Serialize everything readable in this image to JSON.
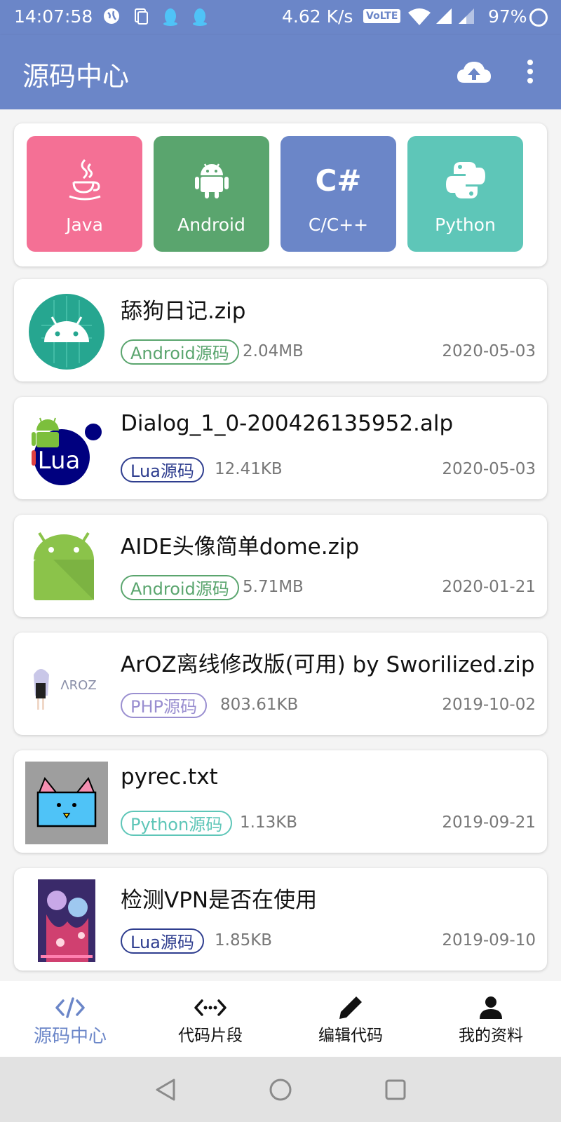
{
  "status_bar": {
    "time": "14:07:58",
    "net_speed": "4.62 K/s",
    "volte": "VoLTE",
    "battery": "97%"
  },
  "app_bar": {
    "title": "源码中心",
    "actions": [
      "upload-cloud-icon",
      "more-vert-icon"
    ]
  },
  "categories": [
    {
      "label": "Java",
      "icon": "java-icon",
      "color": "#f47095"
    },
    {
      "label": "Android",
      "icon": "android-icon",
      "color": "#5aa56e"
    },
    {
      "label": "C/C++",
      "icon": "csharp-icon",
      "glyph": "C#",
      "color": "#6b86c8"
    },
    {
      "label": "Python",
      "icon": "python-icon",
      "color": "#5ec6b8"
    }
  ],
  "files": [
    {
      "name": "舔狗日记.zip",
      "tag": "Android源码",
      "tag_color": "#5aa56e",
      "size": "2.04MB",
      "date": "2020-05-03",
      "icon": "android-round-icon"
    },
    {
      "name": "Dialog_1_0-200426135952.alp",
      "tag": "Lua源码",
      "tag_color": "#2f3e8f",
      "size": "12.41KB",
      "date": "2020-05-03",
      "icon": "lua-logo-icon",
      "thumb_text": "Lua"
    },
    {
      "name": "AIDE头像简单dome.zip",
      "tag": "Android源码",
      "tag_color": "#5aa56e",
      "size": "5.71MB",
      "date": "2020-01-21",
      "icon": "aide-android-icon"
    },
    {
      "name": "ArOZ离线修改版(可用) by Sworilized.zip",
      "tag": "PHP源码",
      "tag_color": "#9a8fd0",
      "size": "803.61KB",
      "date": "2019-10-02",
      "icon": "aroz-logo-icon",
      "thumb_text": "ΛROZ"
    },
    {
      "name": "pyrec.txt",
      "tag": "Python源码",
      "tag_color": "#5ec6b8",
      "size": "1.13KB",
      "date": "2019-09-21",
      "icon": "cat-box-icon"
    },
    {
      "name": "检测VPN是否在使用",
      "tag": "Lua源码",
      "tag_color": "#2f3e8f",
      "size": "1.85KB",
      "date": "2019-09-10",
      "icon": "anime-art-thumbnail"
    }
  ],
  "bottom_nav": [
    {
      "label": "源码中心",
      "icon": "code-icon",
      "active": true
    },
    {
      "label": "代码片段",
      "icon": "code-snippet-icon",
      "active": false
    },
    {
      "label": "编辑代码",
      "icon": "pencil-icon",
      "active": false
    },
    {
      "label": "我的资料",
      "icon": "person-icon",
      "active": false
    }
  ],
  "system_nav": [
    "back-icon",
    "home-icon",
    "recents-icon"
  ]
}
